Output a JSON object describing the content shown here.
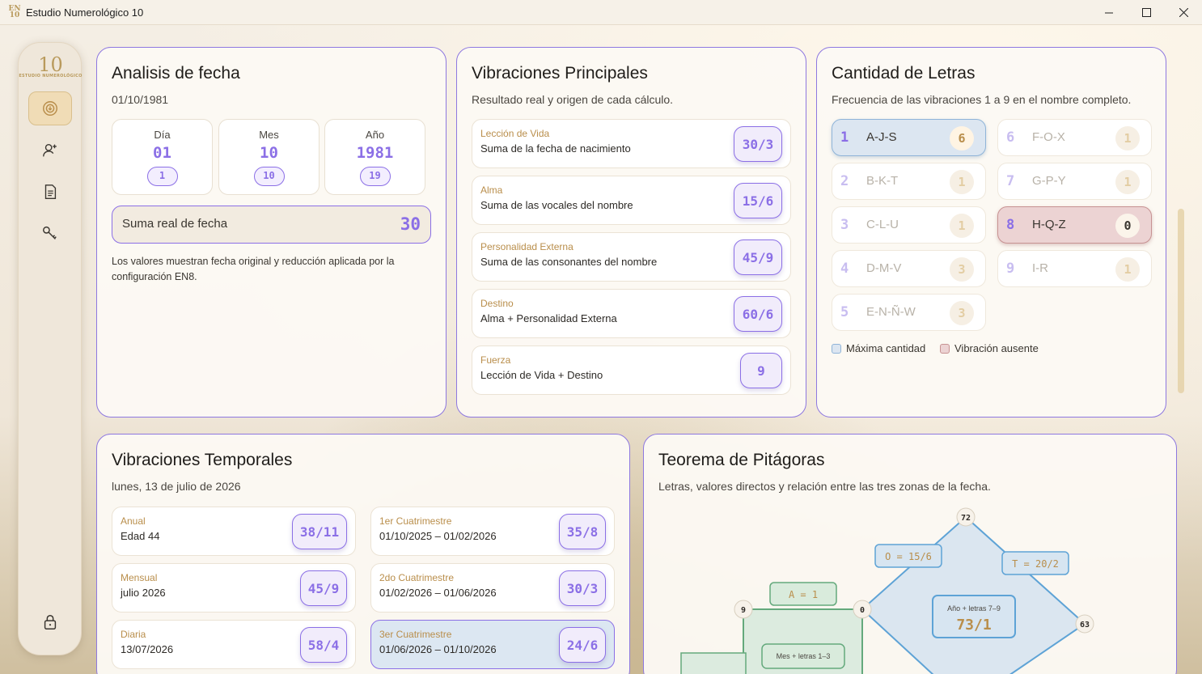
{
  "window": {
    "title": "Estudio Numerológico 10",
    "icon_text": "EN 10"
  },
  "sidebar": {
    "logo_big": "10",
    "logo_small": "ESTUDIO NUMEROLÓGICO",
    "items": [
      {
        "icon": "dashboard-icon",
        "active": true
      },
      {
        "icon": "person-add-icon",
        "active": false
      },
      {
        "icon": "document-icon",
        "active": false
      },
      {
        "icon": "key-icon",
        "active": false
      }
    ],
    "bottom_icon": "lock-icon"
  },
  "analisis": {
    "title": "Analisis de fecha",
    "date": "01/10/1981",
    "boxes": [
      {
        "label": "Día",
        "value": "01",
        "reduced": "1"
      },
      {
        "label": "Mes",
        "value": "10",
        "reduced": "10"
      },
      {
        "label": "Año",
        "value": "1981",
        "reduced": "19"
      }
    ],
    "sum_label": "Suma real de fecha",
    "sum_value": "30",
    "note": "Los valores muestran fecha original y reducción aplicada por la configuración EN8."
  },
  "principales": {
    "title": "Vibraciones Principales",
    "subtitle": "Resultado real y origen de cada cálculo.",
    "rows": [
      {
        "title": "Lección de Vida",
        "desc": "Suma de la fecha de nacimiento",
        "value": "30/3"
      },
      {
        "title": "Alma",
        "desc": "Suma de las vocales del nombre",
        "value": "15/6"
      },
      {
        "title": "Personalidad Externa",
        "desc": "Suma de las consonantes del nombre",
        "value": "45/9"
      },
      {
        "title": "Destino",
        "desc": "Alma + Personalidad Externa",
        "value": "60/6"
      },
      {
        "title": "Fuerza",
        "desc": "Lección de Vida + Destino",
        "value": "9"
      }
    ]
  },
  "letras": {
    "title": "Cantidad de Letras",
    "subtitle": "Frecuencia de las vibraciones 1 a 9 en el nombre completo.",
    "cells": [
      {
        "num": "1",
        "letters": "A-J-S",
        "count": "6",
        "state": "max"
      },
      {
        "num": "6",
        "letters": "F-O-X",
        "count": "1",
        "state": ""
      },
      {
        "num": "2",
        "letters": "B-K-T",
        "count": "1",
        "state": ""
      },
      {
        "num": "7",
        "letters": "G-P-Y",
        "count": "1",
        "state": ""
      },
      {
        "num": "3",
        "letters": "C-L-U",
        "count": "1",
        "state": ""
      },
      {
        "num": "8",
        "letters": "H-Q-Z",
        "count": "0",
        "state": "abs"
      },
      {
        "num": "4",
        "letters": "D-M-V",
        "count": "3",
        "state": ""
      },
      {
        "num": "9",
        "letters": "I-R",
        "count": "1",
        "state": ""
      },
      {
        "num": "5",
        "letters": "E-N-Ñ-W",
        "count": "3",
        "state": ""
      }
    ],
    "legend_max": "Máxima cantidad",
    "legend_abs": "Vibración ausente"
  },
  "temporales": {
    "title": "Vibraciones Temporales",
    "date": "lunes, 13 de julio de 2026",
    "left": [
      {
        "title": "Anual",
        "desc": "Edad 44",
        "value": "38/11"
      },
      {
        "title": "Mensual",
        "desc": "julio 2026",
        "value": "45/9"
      },
      {
        "title": "Diaria",
        "desc": "13/07/2026",
        "value": "58/4"
      }
    ],
    "right": [
      {
        "title": "1er Cuatrimestre",
        "desc": "01/10/2025 – 01/02/2026",
        "value": "35/8",
        "selected": false
      },
      {
        "title": "2do Cuatrimestre",
        "desc": "01/02/2026 – 01/06/2026",
        "value": "30/3",
        "selected": false
      },
      {
        "title": "3er Cuatrimestre",
        "desc": "01/06/2026 – 01/10/2026",
        "value": "24/6",
        "selected": true
      }
    ]
  },
  "pitagoras": {
    "title": "Teorema de Pitágoras",
    "subtitle": "Letras, valores directos y relación entre las tres zonas de la fecha.",
    "nodes": {
      "top": "72",
      "left": "9",
      "mid": "0",
      "right": "63"
    },
    "labels": {
      "o": "O = 15/6",
      "t": "T = 20/2",
      "a": "A = 1"
    },
    "center_caption": "Año + letras 7–9",
    "center_value": "73/1",
    "green_caption": "Mes + letras 1–3"
  },
  "colors": {
    "accent": "#8b6fe6",
    "gold": "#b98e4b",
    "max": "#dce6f1",
    "absent": "#ecd3d3"
  }
}
